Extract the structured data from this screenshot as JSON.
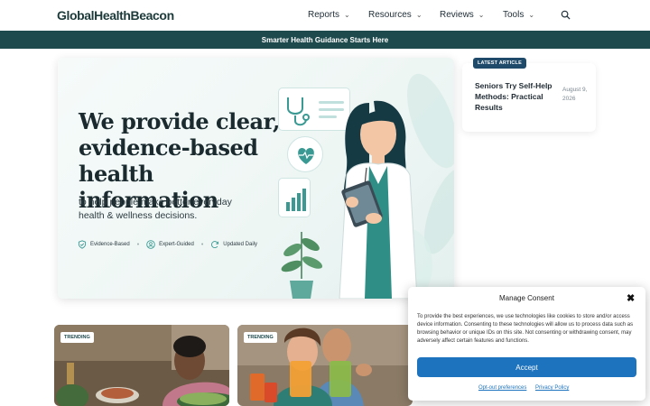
{
  "header": {
    "logo": "GlobalHealthBeacon",
    "nav": [
      {
        "label": "Reports"
      },
      {
        "label": "Resources"
      },
      {
        "label": "Reviews"
      },
      {
        "label": "Tools"
      }
    ]
  },
  "banner": {
    "text": "Smarter Health Guidance Starts Here"
  },
  "hero": {
    "headline": "We provide clear, evidence-based health information",
    "subhead": "to help people make better everyday health & wellness decisions.",
    "badges": [
      "Evidence-Based",
      "Expert-Guided",
      "Updated Daily"
    ]
  },
  "latest": {
    "tag": "LATEST ARTICLE",
    "title": "Seniors Try Self-Help Methods: Practical Results",
    "date": "August 9, 2026"
  },
  "trending": [
    {
      "tag": "TRENDING"
    },
    {
      "tag": "TRENDING"
    }
  ],
  "consent": {
    "title": "Manage Consent",
    "close": "✖",
    "body": "To provide the best experiences, we use technologies like cookies to store and/or access device information. Consenting to these technologies will allow us to process data such as browsing behavior or unique IDs on this site. Not consenting or withdrawing consent, may adversely affect certain features and functions.",
    "accept": "Accept",
    "opt_out": "Opt-out preferences",
    "privacy": "Privacy Policy"
  },
  "colors": {
    "banner": "#1f4a4d",
    "accent": "#1e73be",
    "teal": "#3a9a93"
  }
}
